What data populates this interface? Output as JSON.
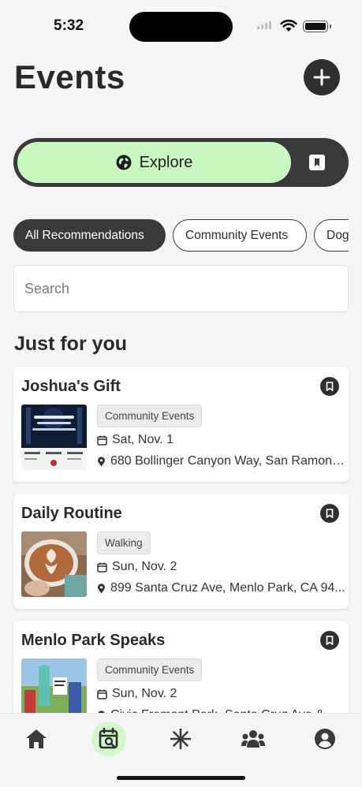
{
  "status_bar": {
    "time": "5:32"
  },
  "header": {
    "title": "Events"
  },
  "segment": {
    "explore_label": "Explore"
  },
  "chips": [
    "All Recommendations",
    "Community Events",
    "Dog"
  ],
  "search": {
    "placeholder": "Search"
  },
  "section": {
    "title": "Just for you"
  },
  "events": [
    {
      "title": "Joshua's Gift",
      "tag": "Community Events",
      "date": "Sat, Nov. 1",
      "location": "680 Bollinger Canyon Way, San Ramon,..."
    },
    {
      "title": "Daily Routine",
      "tag": "Walking",
      "date": "Sun, Nov. 2",
      "location": "899 Santa Cruz Ave, Menlo Park, CA 94..."
    },
    {
      "title": "Menlo Park Speaks",
      "tag": "Community Events",
      "date": "Sun, Nov. 2",
      "location": "Civic Fremont Park, Santa Cruz Ave &..."
    }
  ],
  "tabs": [
    "home-icon",
    "calendar-search-icon",
    "asterisk-icon",
    "group-icon",
    "profile-icon"
  ],
  "colors": {
    "accent_green": "#c9f7c0",
    "dark": "#3a3a3c"
  }
}
